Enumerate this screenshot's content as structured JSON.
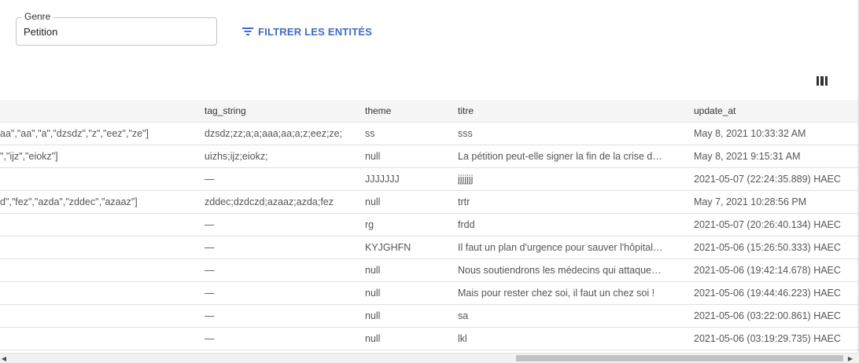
{
  "filter": {
    "genre_label": "Genre",
    "genre_value": "Petition",
    "filter_button_label": "FILTRER LES ENTITÉS",
    "filter_icon": "filter-list-icon",
    "columns_icon": "view-column-icon"
  },
  "columns": {
    "tag_string": "tag_string",
    "theme": "theme",
    "titre": "titre",
    "update_at": "update_at"
  },
  "rows": [
    {
      "tags": "aa\",\"aa\",\"a\",\"dzsdz\",\"z\",\"eez\",\"ze\"]",
      "tag_string": "dzsdz;zz;a;a;aaa;aa;a;z;eez;ze;",
      "theme": "ss",
      "titre": "sss",
      "update_at": "May 8, 2021 10:33:32 AM"
    },
    {
      "tags": "\",\"ijz\",\"eiokz\"]",
      "tag_string": "uizhs;ijz;eiokz;",
      "theme": "null",
      "titre": "La pétition peut-elle signer la fin de la crise d…",
      "update_at": "May 8, 2021 9:15:31 AM"
    },
    {
      "tags": "",
      "tag_string": "—",
      "theme": "JJJJJJJ",
      "titre": "jjjjjjj",
      "update_at": "2021-05-07 (22:24:35.889) HAEC"
    },
    {
      "tags": "d\",\"fez\",\"azda\",\"zddec\",\"azaaz\"]",
      "tag_string": "zddec;dzdczd;azaaz;azda;fez",
      "theme": "null",
      "titre": "trtr",
      "update_at": "May 7, 2021 10:28:56 PM"
    },
    {
      "tags": "",
      "tag_string": "—",
      "theme": "rg",
      "titre": "frdd",
      "update_at": "2021-05-07 (20:26:40.134) HAEC"
    },
    {
      "tags": "",
      "tag_string": "—",
      "theme": "KYJGHFN",
      "titre": "Il faut un plan d'urgence pour sauver l'hôpital…",
      "update_at": "2021-05-06 (15:26:50.333) HAEC"
    },
    {
      "tags": "",
      "tag_string": "—",
      "theme": "null",
      "titre": "Nous soutiendrons les médecins qui attaque…",
      "update_at": "2021-05-06 (19:42:14.678) HAEC"
    },
    {
      "tags": "",
      "tag_string": "—",
      "theme": "null",
      "titre": "Mais pour rester chez soi, il faut un chez soi !",
      "update_at": "2021-05-06 (19:44:46.223) HAEC"
    },
    {
      "tags": "",
      "tag_string": "—",
      "theme": "null",
      "titre": "sa",
      "update_at": "2021-05-06 (03:22:00.861) HAEC"
    },
    {
      "tags": "",
      "tag_string": "—",
      "theme": "null",
      "titre": "lkl",
      "update_at": "2021-05-06 (03:19:29.735) HAEC"
    }
  ],
  "scrollbar": {
    "left_arrow": "◀",
    "right_arrow": "▶"
  }
}
